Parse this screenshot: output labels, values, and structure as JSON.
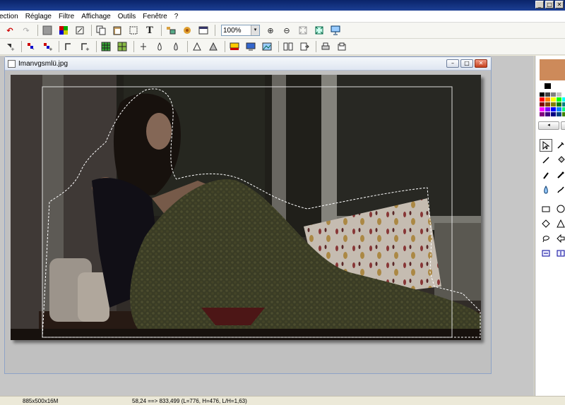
{
  "menu": {
    "items": [
      "ection",
      "Réglage",
      "Filtre",
      "Affichage",
      "Outils",
      "Fenêtre",
      "?"
    ]
  },
  "window_controls": {
    "minimize": "_",
    "maximize": "□",
    "close": "✕"
  },
  "toolbar": {
    "undo_icon": "↶",
    "redo_icon": "↷",
    "text_tool_label": "T",
    "zoom_value": "100%",
    "zoom_dropdown_icon": "▾",
    "zoom_in_icon": "⊕",
    "zoom_out_icon": "⊖"
  },
  "document": {
    "title": "Imanvgsmlü.jpg",
    "image_description": "photo-woman-reading-under-knit-blanket",
    "btn_min": "–",
    "btn_max": "□",
    "btn_close": "✕"
  },
  "right_panel": {
    "primary_color": "#cd8a5a",
    "secondary_color": "#000000",
    "nav_left": "◂",
    "nav_right": "▸",
    "palette": [
      "#000000",
      "#404040",
      "#808080",
      "#c0c0c0",
      "#ffffff",
      "#ff0000",
      "#ff8000",
      "#ffff00",
      "#00ff00",
      "#00ffff",
      "#800000",
      "#804000",
      "#808000",
      "#008000",
      "#008080",
      "#ff00ff",
      "#8000ff",
      "#0000ff",
      "#0080ff",
      "#00ff80",
      "#800080",
      "#400080",
      "#000080",
      "#004080",
      "#408000"
    ]
  },
  "status": {
    "image_info": "885x500x16M",
    "selection_info": "58,24 ==> 833,499 (L=776, H=476, L/H=1,63)"
  }
}
